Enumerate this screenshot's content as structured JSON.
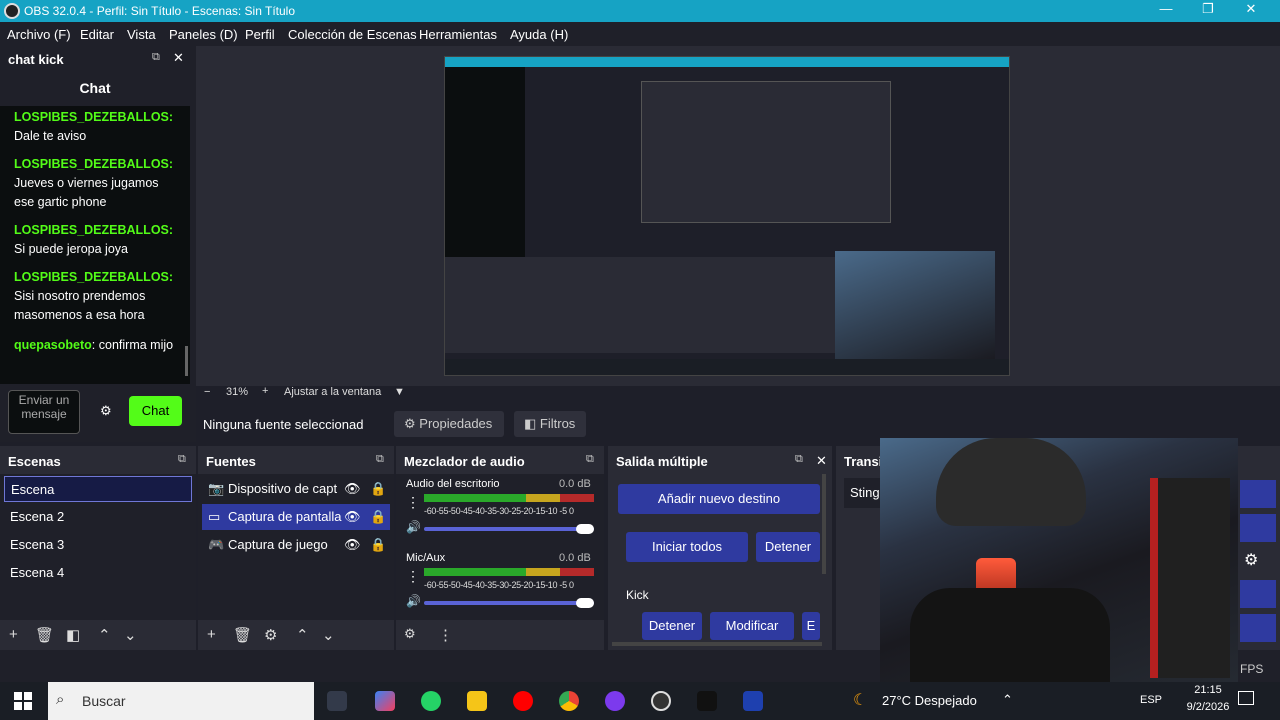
{
  "window": {
    "title": "OBS 32.0.4 - Perfil: Sin Título - Escenas: Sin Título",
    "minimize": "—",
    "maximize": "❐",
    "close": "✕"
  },
  "menu": [
    "Archivo (F)",
    "Editar",
    "Vista",
    "Paneles (D)",
    "Perfil",
    "Colección de Escenas",
    "Herramientas",
    "Ayuda (H)"
  ],
  "chat_dock": {
    "title": "chat kick",
    "tab": "Chat",
    "messages": [
      {
        "user": "LOSPIBES_DEZEBALLOS:",
        "text": "Dale te aviso"
      },
      {
        "user": "LOSPIBES_DEZEBALLOS:",
        "text": "Jueves o viernes jugamos ese gartic phone"
      },
      {
        "user": "LOSPIBES_DEZEBALLOS:",
        "text": "Si puede jeropa joya"
      },
      {
        "user": "LOSPIBES_DEZEBALLOS:",
        "text": "Sisi nosotro prendemos masomenos a esa hora"
      },
      {
        "user": "quepasobeto",
        "text": "confirma mijo"
      }
    ],
    "input_placeholder": "Enviar un mensaje",
    "send_button": "Chat",
    "accent": "#53fc18"
  },
  "zoom": {
    "minus": "−",
    "level": "31%",
    "plus": "+",
    "fit": "Ajustar a la ventana"
  },
  "properties_bar": {
    "no_selection": "Ninguna fuente seleccionad",
    "properties": "Propiedades",
    "filters": "Filtros"
  },
  "scenes": {
    "title": "Escenas",
    "items": [
      "Escena",
      "Escena 2",
      "Escena 3",
      "Escena 4"
    ],
    "selected": 0
  },
  "sources": {
    "title": "Fuentes",
    "items": [
      "Dispositivo de capt",
      "Captura de pantalla",
      "Captura de juego"
    ],
    "selected": 1
  },
  "mixer": {
    "title": "Mezclador de audio",
    "scale": "-60-55-50-45-40-35-30-25-20-15-10 -5 0",
    "channels": [
      {
        "name": "Audio del escritorio",
        "db": "0.0 dB"
      },
      {
        "name": "Mic/Aux",
        "db": "0.0 dB"
      }
    ]
  },
  "multi_output": {
    "title": "Salida múltiple",
    "add_destination": "Añadir nuevo destino",
    "start_all": "Iniciar todos",
    "stop_all": "Detener",
    "target_name": "Kick",
    "stop": "Detener",
    "modify": "Modificar",
    "more": "E"
  },
  "transitions": {
    "title": "Transi",
    "value": "Stinge"
  },
  "status": {
    "fps": "FPS"
  },
  "taskbar": {
    "search": "Buscar",
    "weather": "27°C  Despejado",
    "lang": "ESP",
    "time": "21:15",
    "date": "9/2/2026"
  }
}
